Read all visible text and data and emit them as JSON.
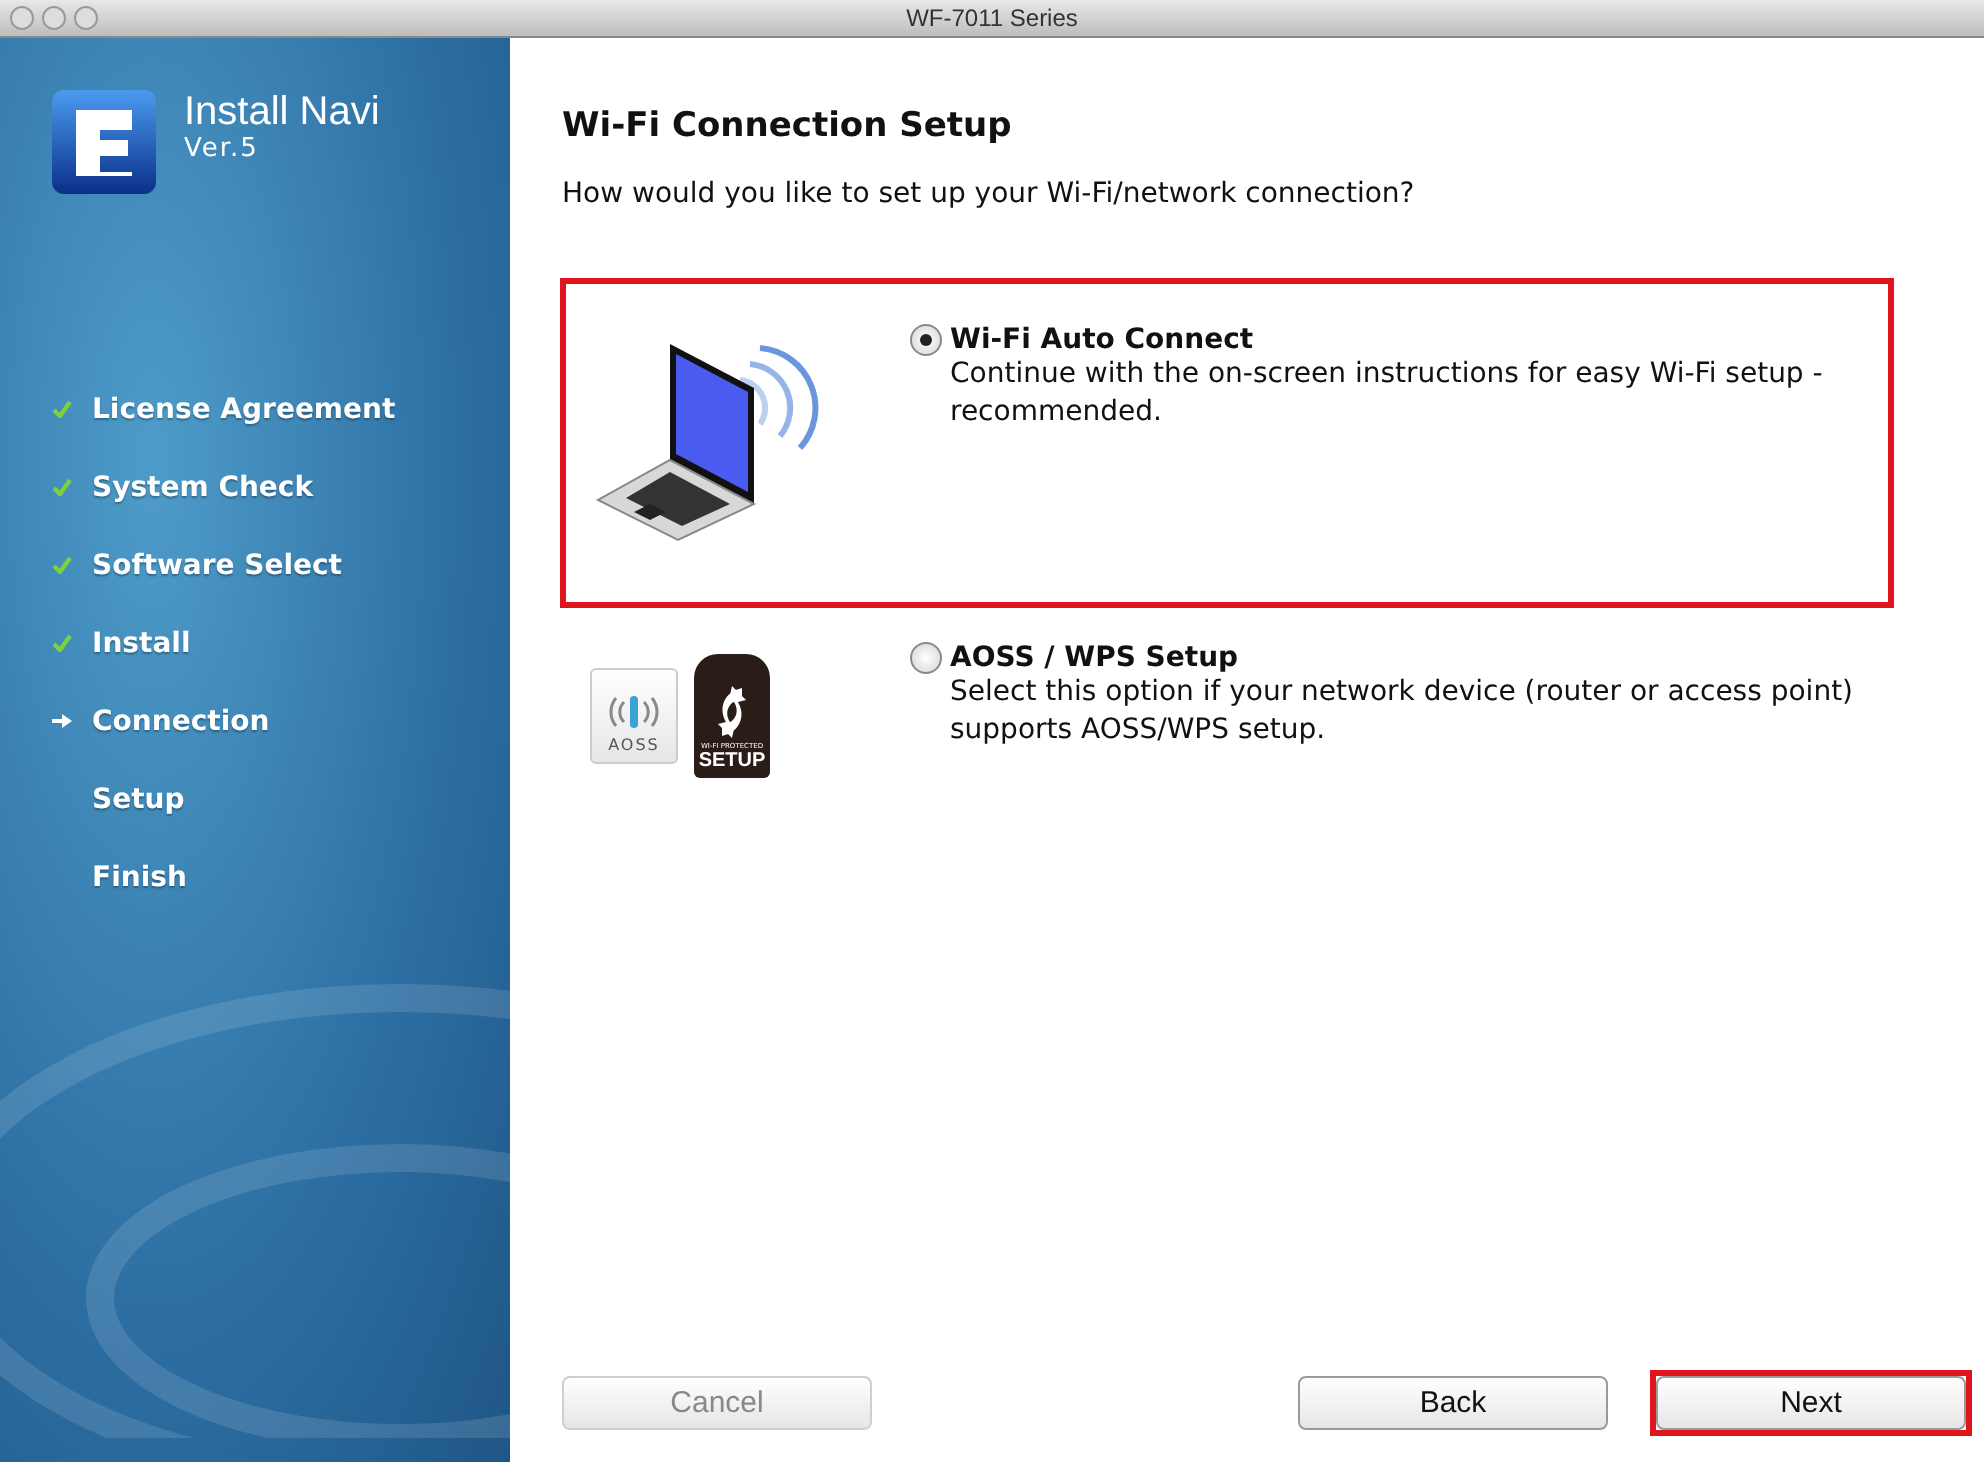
{
  "window": {
    "title": "WF-7011 Series"
  },
  "sidebar": {
    "app_name": "Install Navi",
    "version": "Ver.5",
    "steps": [
      {
        "label": "License Agreement",
        "completed": true,
        "current": false
      },
      {
        "label": "System Check",
        "completed": true,
        "current": false
      },
      {
        "label": "Software Select",
        "completed": true,
        "current": false
      },
      {
        "label": "Install",
        "completed": true,
        "current": false
      },
      {
        "label": "Connection",
        "completed": false,
        "current": true
      },
      {
        "label": "Setup",
        "completed": false,
        "current": false
      },
      {
        "label": "Finish",
        "completed": false,
        "current": false
      }
    ]
  },
  "heading": "Wi-Fi Connection Setup",
  "question": "How would you like to set up your Wi-Fi/network connection?",
  "options": [
    {
      "kind": "laptop",
      "label": "Wi-Fi Auto Connect",
      "description": "Continue with the on-screen instructions for easy Wi-Fi setup - recommended.",
      "selected": true,
      "highlighted": true
    },
    {
      "kind": "aoss_wps",
      "label": "AOSS / WPS Setup",
      "description": "Select this option if your network device (router or access point) supports AOSS/WPS setup.",
      "selected": false,
      "highlighted": false,
      "logo_texts": [
        "AOSS",
        "WI-FI PROTECTED",
        "SETUP"
      ]
    }
  ],
  "buttons": [
    {
      "label": "Cancel",
      "disabled": true,
      "highlighted": false
    },
    {
      "label": "Back",
      "disabled": false,
      "highlighted": false
    },
    {
      "label": "Next",
      "disabled": false,
      "highlighted": true
    }
  ]
}
